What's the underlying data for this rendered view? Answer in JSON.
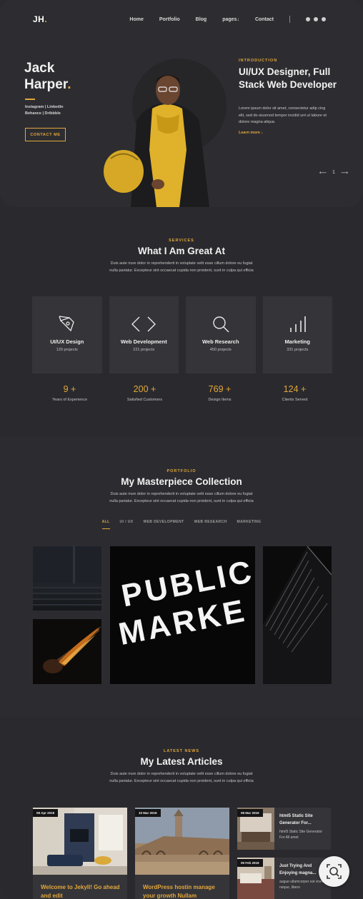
{
  "nav": {
    "logo": "JH",
    "logo_dot": ".",
    "items": [
      "Home",
      "Portfolio",
      "Blog",
      "pages"
    ],
    "pages_arrow": "↓",
    "contact": "Contact",
    "social_icons": [
      "skype-icon",
      "dribbble-icon",
      "twitter-icon"
    ]
  },
  "hero": {
    "name_line1": "Jack",
    "name_line2": "Harper",
    "name_dot": ".",
    "links_line1": "Instagram | Linkedin",
    "links_line2": "Behance | Dribbble",
    "contact_button": "CONTACT ME",
    "intro_label": "INTRODUCTION",
    "intro_title": "UI/UX Designer, Full Stack Web Developer",
    "intro_text": "Lorem ipsum dolor sit amet, consectetur adip cing elit, sed do eiusmod tempor incidid unt ut labore et dolore magna aliqua.",
    "learn_more": "Learn more",
    "learn_more_arrow": "↓",
    "pager_prev": "⟵",
    "pager_current": "1",
    "pager_next": "⟶"
  },
  "services": {
    "label": "SERVICES",
    "title": "What I Am Great At",
    "description": "Duis aute irure dolor in reprehenderit in voluptate velit esse cillum dolore eu fugiat nulla pariatur. Excepteur sint occaecat cupida non proident, sunt in culpa qui officia",
    "cards": [
      {
        "title": "UI/UX Design",
        "sub": "129 projects",
        "icon": "pen-tool-icon"
      },
      {
        "title": "Web Development",
        "sub": "221 projects",
        "icon": "code-brackets-icon"
      },
      {
        "title": "Web Research",
        "sub": "450 projects",
        "icon": "search-icon"
      },
      {
        "title": "Marketing",
        "sub": "331 projects",
        "icon": "bar-chart-icon"
      }
    ],
    "stats": [
      {
        "number": "9 +",
        "label": "Years of Experience"
      },
      {
        "number": "200 +",
        "label": "Satisfied Customers"
      },
      {
        "number": "769 +",
        "label": "Design Items"
      },
      {
        "number": "124 +",
        "label": "Clients Served"
      }
    ]
  },
  "portfolio": {
    "label": "PORTFOLIO",
    "title": "My Masterpiece Collection",
    "description": "Duis aute irure dolor in reprehenderit in voluptate velit esse cillum dolore eu fugiat nulla pariatur. Excepteur sint occaecat cupida non proident, sunt in culpa qui officia",
    "filters": [
      "ALL",
      "UI / UX",
      "WEB DEVELOPMENT",
      "WEB RESEARCH",
      "MARKETING"
    ],
    "sign_line1": "PUBLIC",
    "sign_line2": "MARKE"
  },
  "articles": {
    "label": "LATEST NEWS",
    "title": "My Latest Articles",
    "description": "Duis aute irure dolor in reprehenderit in voluptate velit esse cillum dolore eu fugiat nulla pariatur. Excepteur sint occaecat cupida non proident, sunt in culpa qui officia",
    "main": [
      {
        "date": "08 Apr 2019",
        "title": "Welcome to Jekyll! Go ahead and edit"
      },
      {
        "date": "10 Mar 2019",
        "title": "WordPress hostin manage your growth Nullam"
      }
    ],
    "side": [
      {
        "date": "08 Mar 2019",
        "title": "html5 Static Site Generator For...",
        "desc": "html5 Static Site Generator For All amet"
      },
      {
        "date": "09 Feb 2019",
        "title": "Just Trying And Enjoying magna...",
        "desc": "augue ullamcorper est viverra neque, libero"
      }
    ]
  },
  "colors": {
    "accent": "#e3a73a",
    "background": "#2a2a2e",
    "card": "#353539"
  }
}
